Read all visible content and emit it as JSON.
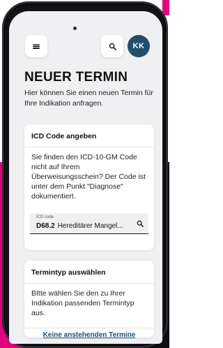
{
  "colors": {
    "accent_magenta": "#e5007e",
    "avatar_bg": "#1f4f6d",
    "link": "#1f4f6d",
    "screen_bg": "#f0f0f3"
  },
  "header": {
    "menu_icon": "hamburger-menu-icon",
    "search_icon": "search-icon",
    "avatar_initials": "KK"
  },
  "page": {
    "title": "NEUER TERMIN",
    "subtitle": "Hier können Sie einen neuen Termin für Ihre Indikation anfragen."
  },
  "icd_card": {
    "title": "ICD Code angeben",
    "text": "Sie finden den ICD-10-GM Code nicht auf Ihrem Überweisungsschein? Der Code ist unter dem Punkt \"Diagnose\" dokumentiert.",
    "field_label": "ICD code",
    "field_code": "D68.2",
    "field_value": "Hereditärer Mangel...",
    "field_icon": "search-icon"
  },
  "termintyp_card": {
    "title": "Termintyp auswählen",
    "text": "BItte wählen Sie den zu Ihrer Indikation passenden Termintyp aus.",
    "footer_link": "Keine anstehenden Termine"
  }
}
